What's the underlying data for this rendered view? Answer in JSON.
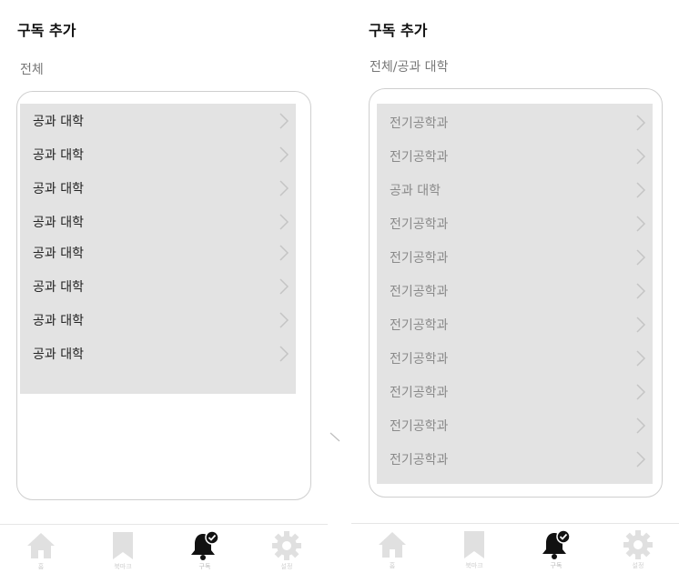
{
  "left": {
    "title": "구독 추가",
    "breadcrumb": "전체",
    "items": [
      {
        "label": "공과 대학"
      },
      {
        "label": "공과 대학"
      },
      {
        "label": "공과 대학"
      },
      {
        "label": "공과 대학"
      },
      {
        "label": "공과 대학"
      },
      {
        "label": "공과 대학"
      },
      {
        "label": "공과 대학"
      },
      {
        "label": "공과 대학"
      }
    ]
  },
  "right": {
    "title": "구독 추가",
    "breadcrumb": "전체/공과 대학",
    "items": [
      {
        "label": "전기공학과"
      },
      {
        "label": "전기공학과"
      },
      {
        "label": "공과 대학"
      },
      {
        "label": "전기공학과"
      },
      {
        "label": "전기공학과"
      },
      {
        "label": "전기공학과"
      },
      {
        "label": "전기공학과"
      },
      {
        "label": "전기공학과"
      },
      {
        "label": "전기공학과"
      },
      {
        "label": "전기공학과"
      },
      {
        "label": "전기공학과"
      }
    ]
  },
  "tabbar": {
    "tabs": [
      {
        "label": "홈",
        "icon": "home-icon"
      },
      {
        "label": "북마크",
        "icon": "bookmark-icon"
      },
      {
        "label": "구독",
        "icon": "bell-check-icon",
        "active": true
      },
      {
        "label": "설정",
        "icon": "gear-icon"
      }
    ]
  },
  "colors": {
    "list_bg": "#e3e3e3",
    "inactive_icon": "#e0e0e0",
    "active_icon": "#111111",
    "muted_text": "#8a8a8a"
  }
}
